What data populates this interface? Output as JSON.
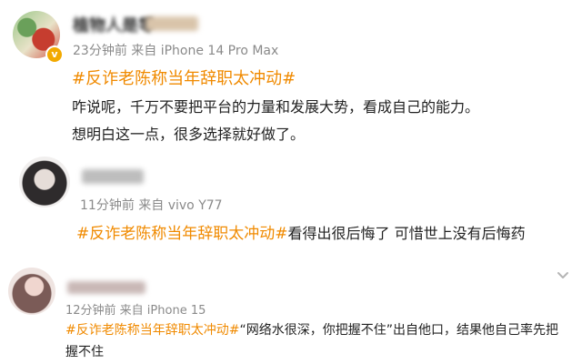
{
  "colors": {
    "topic": "#f08a00",
    "meta": "#8a8a8a",
    "text": "#222222"
  },
  "comments": [
    {
      "name": "植物人是零",
      "meta": "23分钟前  来自 iPhone 14 Pro Max",
      "badge_icon": "verified-v-icon",
      "topic": "#反诈老陈称当年辞职太冲动#",
      "lines": [
        "咋说呢，千万不要把平台的力量和发展大势，看成自己的能力。",
        "想明白这一点，很多选择就好做了。"
      ]
    },
    {
      "name": "",
      "meta": "11分钟前  来自 vivo Y77",
      "topic": "#反诈老陈称当年辞职太冲动#",
      "text": "看得出很后悔了 可惜世上没有后悔药"
    },
    {
      "name": "",
      "meta": "12分钟前  来自 iPhone 15",
      "topic": "#反诈老陈称当年辞职太冲动#",
      "line1": "“网络水很深，你把握不住”出自他口，结果他自己率先把",
      "line2": "握不住"
    }
  ],
  "menu_icon": "chevron-down-icon"
}
